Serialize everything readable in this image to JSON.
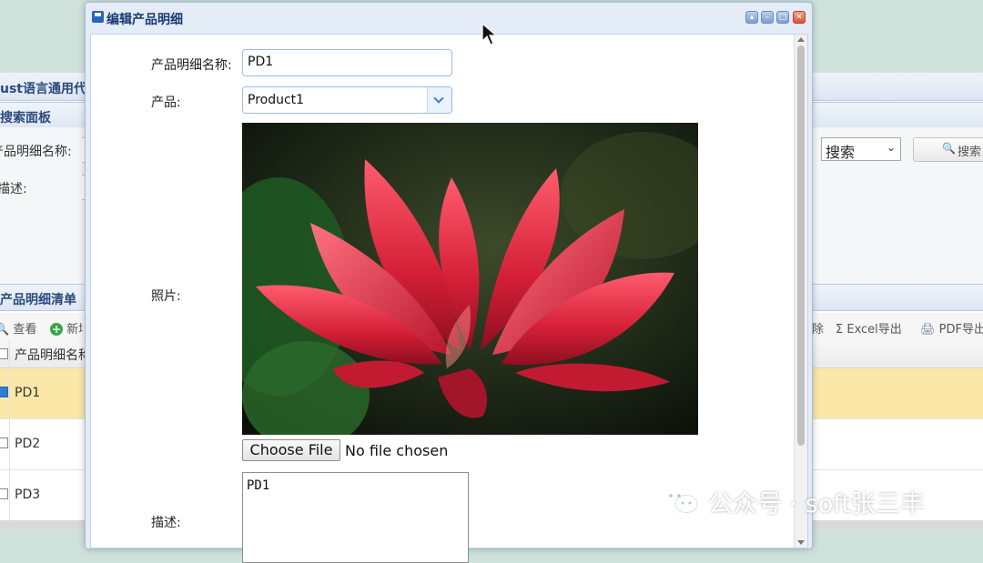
{
  "background": {
    "window_title": "ust语言通用代",
    "search_panel": {
      "title": "搜索面板",
      "name_label": "产品明细名称:",
      "desc_label": "描述:",
      "search_select": "搜索",
      "search_button": "搜索"
    },
    "list_panel": {
      "title": "产品明细清单",
      "toolbar": {
        "view": "查看",
        "add": "新增",
        "delete": "除",
        "excel": "Excel导出",
        "pdf": "PDF导出"
      },
      "column_header": "产品明细名称",
      "rows": [
        {
          "name": "PD1",
          "checked": true
        },
        {
          "name": "PD2",
          "checked": false
        },
        {
          "name": "PD3",
          "checked": false
        }
      ]
    }
  },
  "dialog": {
    "title": "编辑产品明细",
    "fields": {
      "name_label": "产品明细名称:",
      "name_value": "PD1",
      "product_label": "产品:",
      "product_value": "Product1",
      "photo_label": "照片:",
      "file_button": "Choose File",
      "file_status": "No file chosen",
      "desc_label": "描述:",
      "desc_value": "PD1"
    }
  },
  "watermark": "公众号 · soft张三丰",
  "icons": [
    "save-icon",
    "collapse-icon",
    "minimize-icon",
    "maximize-icon",
    "close-icon",
    "search-icon",
    "view-icon",
    "add-icon",
    "sigma-icon",
    "pdf-icon",
    "chevron-down-icon",
    "mouse-cursor-icon",
    "wechat-icon"
  ],
  "colors": {
    "accent": "#2a63b7",
    "title_text": "#183a72",
    "selected_row": "#fbe8a9",
    "close_button": "#d9553a"
  }
}
